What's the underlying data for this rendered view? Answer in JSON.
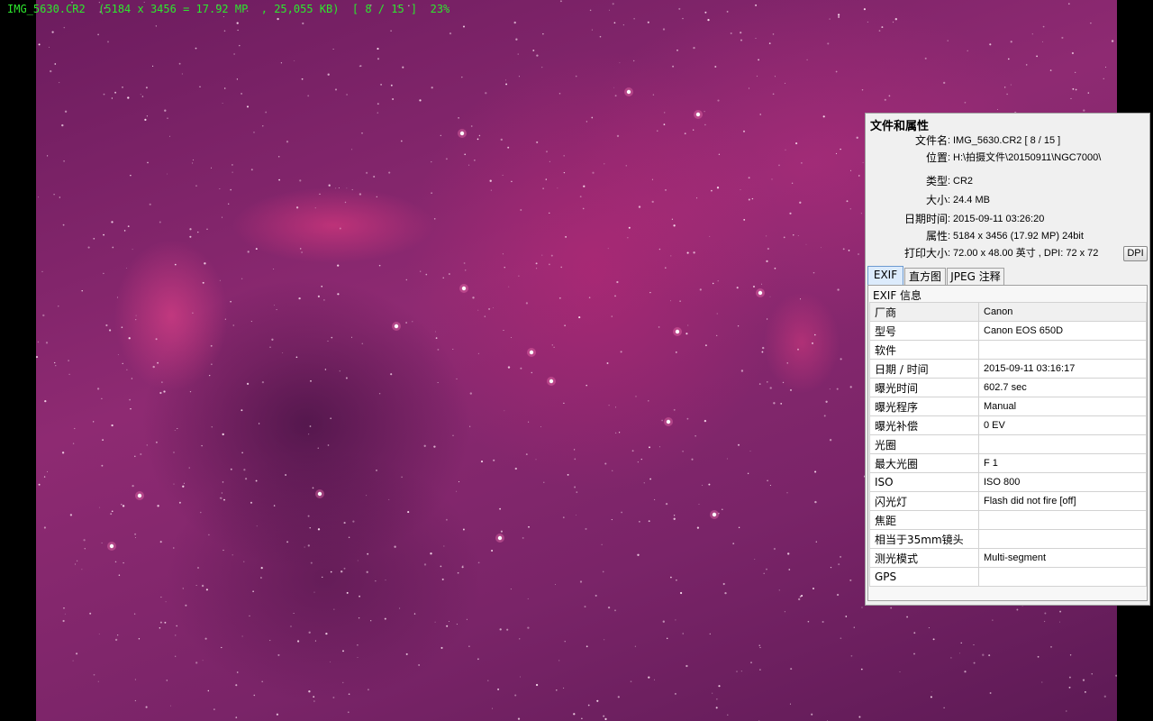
{
  "viewer": {
    "title": "IMG_5630.CR2  (5184 x 3456 = 17.92 MP  , 25,055 KB)  [ 8 / 15 ]  23%",
    "title_color": "#2de82d",
    "background": "#000000"
  },
  "panel": {
    "title": "文件和属性",
    "props": [
      {
        "label": "文件名",
        "value": "IMG_5630.CR2   [ 8 / 15 ]"
      },
      {
        "label": "位置",
        "value": "H:\\拍摄文件\\20150911\\NGC7000\\"
      },
      {
        "label": "类型",
        "value": "CR2"
      },
      {
        "label": "大小",
        "value": "24.4 MB"
      },
      {
        "label": "日期时间",
        "value": "2015-09-11 03:26:20"
      },
      {
        "label": "属性",
        "value": "5184 x 3456 (17.92 MP)  24bit"
      },
      {
        "label": "打印大小",
        "value": "72.00 x 48.00 英寸 ,  DPI: 72 x 72"
      }
    ],
    "dpi_button": "DPI",
    "tabs": [
      {
        "label": "EXIF",
        "active": true
      },
      {
        "label": "直方图",
        "active": false
      },
      {
        "label": "JPEG 注释",
        "active": false
      }
    ],
    "exif_header": "EXIF 信息",
    "exif_rows": [
      {
        "key": "厂商",
        "value": "Canon"
      },
      {
        "key": "型号",
        "value": "Canon EOS 650D"
      },
      {
        "key": "软件",
        "value": ""
      },
      {
        "key": "日期 / 时间",
        "value": "2015-09-11 03:16:17"
      },
      {
        "key": "曝光时间",
        "value": "602.7 sec"
      },
      {
        "key": "曝光程序",
        "value": "Manual"
      },
      {
        "key": "曝光补偿",
        "value": "0 EV"
      },
      {
        "key": "光圈",
        "value": ""
      },
      {
        "key": "最大光圈",
        "value": "F 1"
      },
      {
        "key": "ISO",
        "value": "ISO 800"
      },
      {
        "key": "闪光灯",
        "value": "Flash did not fire [off]"
      },
      {
        "key": "焦距",
        "value": ""
      },
      {
        "key": "相当于35mm镜头",
        "value": ""
      },
      {
        "key": "测光模式",
        "value": "Multi-segment"
      },
      {
        "key": "GPS",
        "value": ""
      }
    ],
    "active_tab_color": "#dcebfc"
  }
}
